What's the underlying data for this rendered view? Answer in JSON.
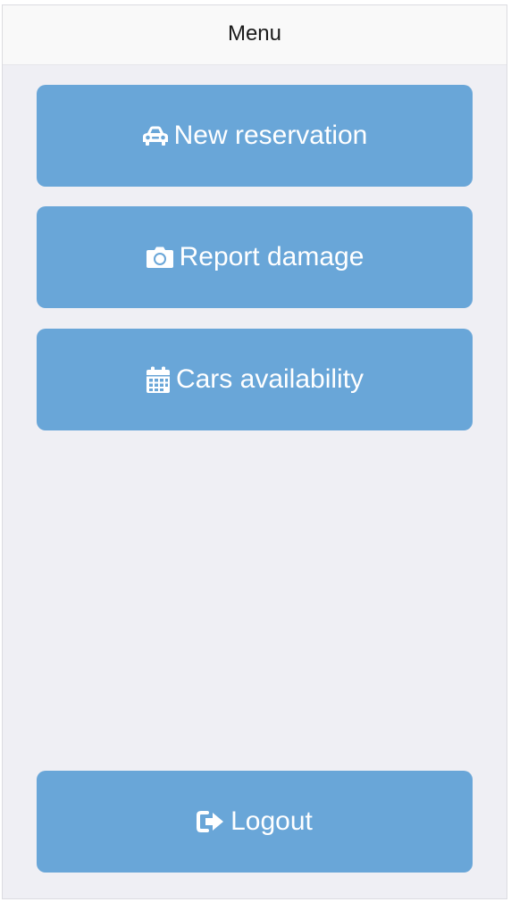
{
  "navbar": {
    "title": "Menu"
  },
  "menu": {
    "items": [
      {
        "label": "New reservation",
        "icon": "car-icon"
      },
      {
        "label": "Report damage",
        "icon": "camera-icon"
      },
      {
        "label": "Cars availability",
        "icon": "calendar-icon"
      }
    ],
    "logout": {
      "label": "Logout",
      "icon": "sign-out-icon"
    }
  },
  "colors": {
    "button_bg": "#69a6d8",
    "button_text": "#ffffff",
    "page_bg": "#efeff4",
    "navbar_bg": "#f9f9f9"
  }
}
